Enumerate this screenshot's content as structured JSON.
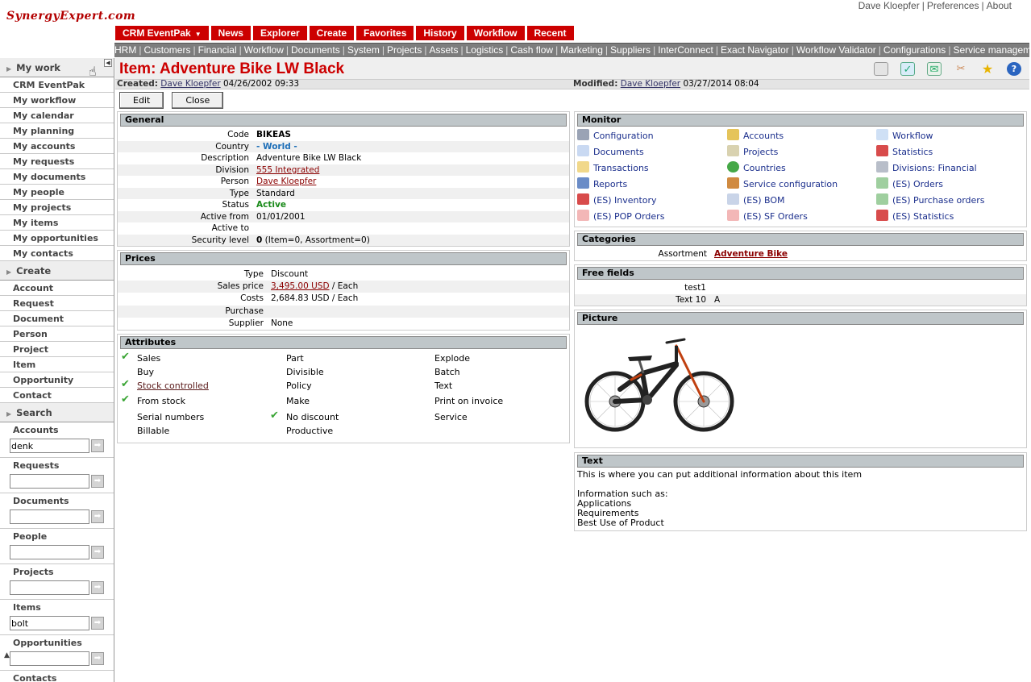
{
  "header": {
    "logo_text": "SynergyExpert.com",
    "user_name": "Dave Kloepfer",
    "preferences": "Preferences",
    "about": "About"
  },
  "main_menu": [
    "CRM EventPak",
    "News",
    "Explorer",
    "Create",
    "Favorites",
    "History",
    "Workflow",
    "Recent"
  ],
  "sub_menu": [
    "HRM",
    "Customers",
    "Financial",
    "Workflow",
    "Documents",
    "System",
    "Projects",
    "Assets",
    "Logistics",
    "Cash flow",
    "Marketing",
    "Suppliers",
    "InterConnect",
    "Exact Navigator",
    "Workflow Validator",
    "Configurations",
    "Service management"
  ],
  "sidebar": {
    "my_work_title": "My work",
    "my_work_items": [
      "CRM EventPak",
      "My workflow",
      "My calendar",
      "My planning",
      "My accounts",
      "My requests",
      "My documents",
      "My people",
      "My projects",
      "My items",
      "My opportunities",
      "My contacts"
    ],
    "create_title": "Create",
    "create_items": [
      "Account",
      "Request",
      "Document",
      "Person",
      "Project",
      "Item",
      "Opportunity",
      "Contact"
    ],
    "search_title": "Search",
    "search_fields": [
      {
        "label": "Accounts",
        "value": "denk"
      },
      {
        "label": "Requests",
        "value": ""
      },
      {
        "label": "Documents",
        "value": ""
      },
      {
        "label": "People",
        "value": ""
      },
      {
        "label": "Projects",
        "value": ""
      },
      {
        "label": "Items",
        "value": "bolt"
      },
      {
        "label": "Opportunities",
        "value": ""
      }
    ],
    "cut_off_label": "Contacts"
  },
  "page": {
    "title": "Item: Adventure Bike LW Black",
    "created_label": "Created:",
    "created_by": "Dave Kloepfer",
    "created_at": "04/26/2002 09:33",
    "modified_label": "Modified:",
    "modified_by": "Dave Kloepfer",
    "modified_at": "03/27/2014 08:04",
    "edit_label": "Edit",
    "close_label": "Close"
  },
  "general": {
    "title": "General",
    "rows": [
      {
        "key": "Code",
        "value": "BIKEAS"
      },
      {
        "key": "Country",
        "value": "- World -"
      },
      {
        "key": "Description",
        "value": "Adventure Bike LW Black"
      },
      {
        "key": "Division",
        "value": "555 Integrated"
      },
      {
        "key": "Person",
        "value": "Dave Kloepfer"
      },
      {
        "key": "Type",
        "value": "Standard"
      },
      {
        "key": "Status",
        "value": "Active"
      },
      {
        "key": "Active from",
        "value": "01/01/2001"
      },
      {
        "key": "Active to",
        "value": ""
      },
      {
        "key": "Security level",
        "value": "0",
        "extra": " (Item=0, Assortment=0)"
      }
    ]
  },
  "prices": {
    "title": "Prices",
    "rows": [
      {
        "key": "Type",
        "value": "Discount"
      },
      {
        "key": "Sales price",
        "value": "3,495.00 USD",
        "extra": " / Each"
      },
      {
        "key": "Costs",
        "value": "2,684.83 USD / Each"
      },
      {
        "key": "Purchase",
        "value": ""
      },
      {
        "key": "Supplier",
        "value": "None"
      }
    ]
  },
  "attributes": {
    "title": "Attributes",
    "columns": [
      [
        {
          "label": "Sales",
          "checked": true
        },
        {
          "label": "Buy",
          "checked": false
        },
        {
          "label": "Stock controlled",
          "checked": true
        },
        {
          "label": "From stock",
          "checked": true
        },
        {
          "label": "Serial numbers",
          "checked": false
        },
        {
          "label": "Billable",
          "checked": false
        }
      ],
      [
        {
          "label": "Part",
          "checked": false
        },
        {
          "label": "Divisible",
          "checked": false
        },
        {
          "label": "Policy",
          "checked": false
        },
        {
          "label": "Make",
          "checked": false
        },
        {
          "label": "No discount",
          "checked": true
        },
        {
          "label": "Productive",
          "checked": false
        }
      ],
      [
        {
          "label": "Explode",
          "checked": false
        },
        {
          "label": "Batch",
          "checked": false
        },
        {
          "label": "Text",
          "checked": false
        },
        {
          "label": "Print on invoice",
          "checked": false
        },
        {
          "label": "Service",
          "checked": false
        }
      ]
    ]
  },
  "monitor": {
    "title": "Monitor",
    "items": [
      {
        "label": "Configuration",
        "icon": "wrench-icon"
      },
      {
        "label": "Accounts",
        "icon": "people-icon"
      },
      {
        "label": "Workflow",
        "icon": "workflow-icon"
      },
      {
        "label": "Documents",
        "icon": "documents-icon"
      },
      {
        "label": "Projects",
        "icon": "projects-icon"
      },
      {
        "label": "Statistics",
        "icon": "chart-icon"
      },
      {
        "label": "Transactions",
        "icon": "checklist-icon"
      },
      {
        "label": "Countries",
        "icon": "globe-icon"
      },
      {
        "label": "Divisions: Financial",
        "icon": "division-icon"
      },
      {
        "label": "Reports",
        "icon": "report-icon"
      },
      {
        "label": "Service configuration",
        "icon": "service-icon"
      },
      {
        "label": "(ES) Orders",
        "icon": "orders-icon"
      },
      {
        "label": "(ES) Inventory",
        "icon": "chart-icon"
      },
      {
        "label": "(ES) BOM",
        "icon": "table-icon"
      },
      {
        "label": "(ES) Purchase orders",
        "icon": "orders-icon"
      },
      {
        "label": "(ES) POP Orders",
        "icon": "doc-icon"
      },
      {
        "label": "(ES) SF Orders",
        "icon": "doc-icon"
      },
      {
        "label": "(ES) Statistics",
        "icon": "chart-icon"
      }
    ]
  },
  "categories": {
    "title": "Categories",
    "key": "Assortment",
    "value": "Adventure Bike"
  },
  "free_fields": {
    "title": "Free fields",
    "rows": [
      {
        "key": "test1",
        "value": ""
      },
      {
        "key": "Text 10",
        "value": "A"
      }
    ]
  },
  "picture": {
    "title": "Picture",
    "alt": "bike-image"
  },
  "text_panel": {
    "title": "Text",
    "lines": [
      "This is where you can put additional information about this item",
      "",
      "Information such as:",
      "Applications",
      "Requirements",
      "Best Use of Product"
    ]
  },
  "colors": {
    "brand_red": "#cc0000",
    "link_blue": "#1a2e8c",
    "check_green": "#3aa535"
  }
}
